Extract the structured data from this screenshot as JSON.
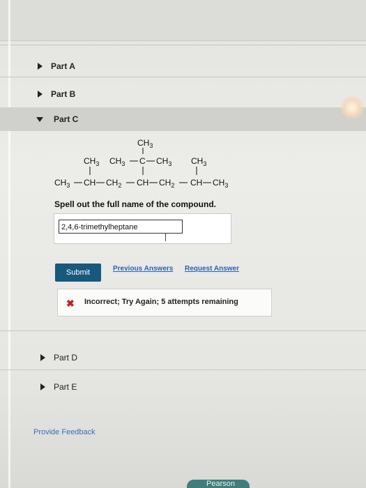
{
  "parts": {
    "a": {
      "label": "Part A"
    },
    "b": {
      "label": "Part B"
    },
    "c": {
      "label": "Part C"
    },
    "d": {
      "label": "Part D"
    },
    "e": {
      "label": "Part E"
    }
  },
  "structure": {
    "top_ch3": "CH3",
    "row2_left": "CH3",
    "row2_mid_left": "CH3",
    "row2_c": "C",
    "row2_mid_right": "CH3",
    "row2_right": "CH3",
    "main_chain": [
      "CH3",
      "CH",
      "CH2",
      "CH",
      "CH2",
      "CH",
      "CH3"
    ]
  },
  "question": {
    "prompt": "Spell out the full name of the compound.",
    "answer_value": "2,4,6-trimethylheptane"
  },
  "buttons": {
    "submit": "Submit",
    "previous_answers": "Previous Answers",
    "request_answer": "Request Answer"
  },
  "feedback": {
    "icon": "x-icon",
    "text": "Incorrect; Try Again; 5 attempts remaining",
    "color": "#c41e1e"
  },
  "footer": {
    "provide_feedback": "Provide Feedback",
    "brand": "Pearson"
  },
  "colors": {
    "submit_bg": "#17587d",
    "link": "#2a63b3"
  }
}
